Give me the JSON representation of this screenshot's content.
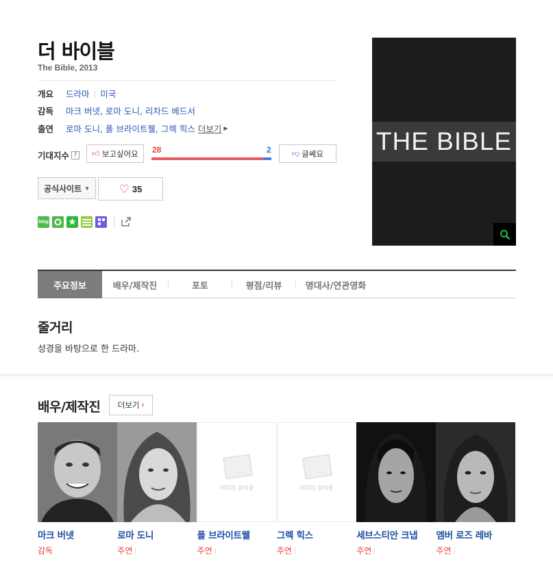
{
  "movie": {
    "title": "더 바이블",
    "subtitle": "The Bible, 2013"
  },
  "info": {
    "overview_label": "개요",
    "genre": "드라마",
    "country": "미국",
    "director_label": "감독",
    "directors": "마크 버넷, 로마 도니, 리차드 베드서",
    "cast_label": "출연",
    "cast": "로마 도니, 폴 브라이트웰, 그렉 힉스",
    "cast_more": "더보기"
  },
  "expect": {
    "label": "기대지수",
    "help": "?",
    "want_label": "보고싶어요",
    "want_count": "28",
    "nah_label": "글쎄요",
    "nah_count": "2",
    "want_ratio": 0.93
  },
  "actions": {
    "official_site": "공식사이트",
    "like_count": "35"
  },
  "share_icons": [
    {
      "name": "blog-share-icon",
      "label": "blog",
      "color": "#4cb94a"
    },
    {
      "name": "band-share-icon",
      "label": "",
      "color": "#4cb94a"
    },
    {
      "name": "bookmark-star-icon",
      "label": "",
      "color": "#2bb934"
    },
    {
      "name": "memo-share-icon",
      "label": "",
      "color": "#7ec93a"
    },
    {
      "name": "post-share-icon",
      "label": "",
      "color": "#6d5ce6"
    }
  ],
  "poster": {
    "text": "THE BIBLE"
  },
  "tabs": [
    "주요정보",
    "배우/제작진",
    "포토",
    "평점/리뷰",
    "명대사/연관영화"
  ],
  "synopsis": {
    "heading": "줄거리",
    "text": "성경을 바탕으로 한 드라마."
  },
  "crew": {
    "heading": "배우/제작진",
    "more": "더보기",
    "prep_text": "이미지 준비중",
    "members": [
      {
        "name": "마크 버넷",
        "role": "감독",
        "photo": "person"
      },
      {
        "name": "로마 도니",
        "role": "주연",
        "photo": "person"
      },
      {
        "name": "폴 브라이트웰",
        "role": "주연",
        "photo": "placeholder"
      },
      {
        "name": "그렉 힉스",
        "role": "주연",
        "photo": "placeholder"
      },
      {
        "name": "세브스티안 크냅",
        "role": "주연",
        "photo": "person"
      },
      {
        "name": "엠버 로즈 레바",
        "role": "주연",
        "photo": "person"
      }
    ]
  }
}
